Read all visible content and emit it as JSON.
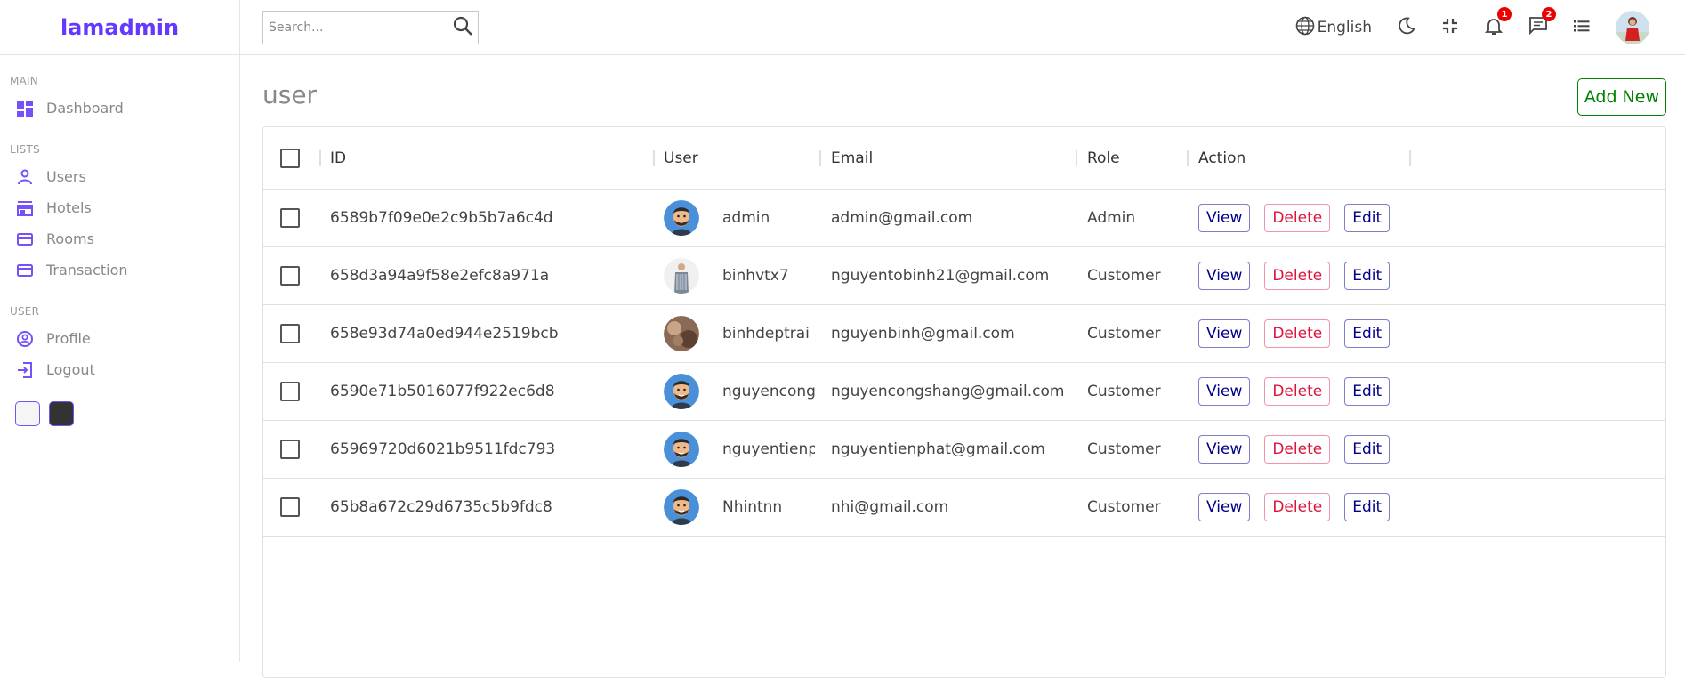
{
  "sidebar": {
    "logo": "lamadmin",
    "sections": {
      "main": "MAIN",
      "lists": "LISTS",
      "user": "USER"
    },
    "items": {
      "dashboard": "Dashboard",
      "users": "Users",
      "hotels": "Hotels",
      "rooms": "Rooms",
      "transaction": "Transaction",
      "profile": "Profile",
      "logout": "Logout"
    },
    "accent_color": "#7451f8"
  },
  "navbar": {
    "search_placeholder": "Search...",
    "language": "English",
    "notifications_count": "1",
    "messages_count": "2"
  },
  "page": {
    "title": "user",
    "add_new": "Add New"
  },
  "table": {
    "columns": {
      "id": "ID",
      "user": "User",
      "email": "Email",
      "role": "Role",
      "action": "Action"
    },
    "actions": {
      "view": "View",
      "delete": "Delete",
      "edit": "Edit"
    },
    "rows": [
      {
        "id": "6589b7f09e0e2c9b5b7a6c4d",
        "username": "admin",
        "email": "admin@gmail.com",
        "role": "Admin",
        "avatar": "cartoon-avatar"
      },
      {
        "id": "658d3a94a9f58e2efc8a971a",
        "username": "binhvtx7",
        "email": "nguyentobinh21@gmail.com",
        "role": "Customer",
        "avatar": "photo-avatar"
      },
      {
        "id": "658e93d74a0ed944e2519bcb",
        "username": "binhdeptrai",
        "email": "nguyenbinh@gmail.com",
        "role": "Customer",
        "avatar": "photo-avatar"
      },
      {
        "id": "6590e71b5016077f922ec6d8",
        "username": "nguyencongshang",
        "email": "nguyencongshang@gmail.com",
        "role": "Customer",
        "avatar": "cartoon-avatar"
      },
      {
        "id": "65969720d6021b9511fdc793",
        "username": "nguyentienphat",
        "email": "nguyentienphat@gmail.com",
        "role": "Customer",
        "avatar": "cartoon-avatar"
      },
      {
        "id": "65b8a672c29d6735c5b9fdc8",
        "username": "Nhintnn",
        "email": "nhi@gmail.com",
        "role": "Customer",
        "avatar": "cartoon-avatar"
      }
    ]
  }
}
